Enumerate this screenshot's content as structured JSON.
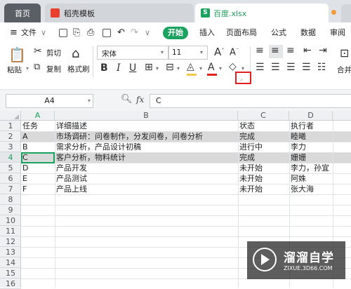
{
  "tabs": {
    "home": "首页",
    "template": "稻壳模板",
    "file": "百度.xlsx"
  },
  "menu": {
    "file_label": "文件",
    "items": [
      "开始",
      "插入",
      "页面布局",
      "公式",
      "数据",
      "审阅"
    ]
  },
  "ribbon": {
    "paste": "粘贴",
    "cut": "剪切",
    "copy": "复制",
    "format_painter": "格式刷",
    "font_name": "宋体",
    "font_size": "11",
    "merge": "合并"
  },
  "formula_bar": {
    "name_box": "A4",
    "fx": "fx",
    "content": "C"
  },
  "columns": [
    "A",
    "B",
    "C",
    "D"
  ],
  "row_numbers": [
    "1",
    "2",
    "3",
    "4",
    "5",
    "6",
    "7",
    "8",
    "9",
    "10",
    "11",
    "12",
    "13",
    "14",
    "15",
    "16"
  ],
  "rows": [
    [
      "任务",
      "详细描述",
      "状态",
      "执行者"
    ],
    [
      "A",
      "市场调研：问卷制作，分发问卷，问卷分析",
      "完成",
      "睦曦"
    ],
    [
      "B",
      "需求分析，产品设计初稿",
      "进行中",
      "李力"
    ],
    [
      "C",
      "客户分析，物料统计",
      "完成",
      "姗姗"
    ],
    [
      "D",
      "产品开发",
      "未开始",
      "李力，孙宜"
    ],
    [
      "E",
      "产品测试",
      "未开始",
      "阿姝"
    ],
    [
      "F",
      "产品上线",
      "未开始",
      "张大海"
    ]
  ],
  "watermark": {
    "title": "溜溜自学",
    "url": "ZIXUE.3D66.COM"
  },
  "colors": {
    "accent": "#1aa260",
    "highlight": "#e21f1f",
    "grey_row": "#d9d9d9"
  }
}
